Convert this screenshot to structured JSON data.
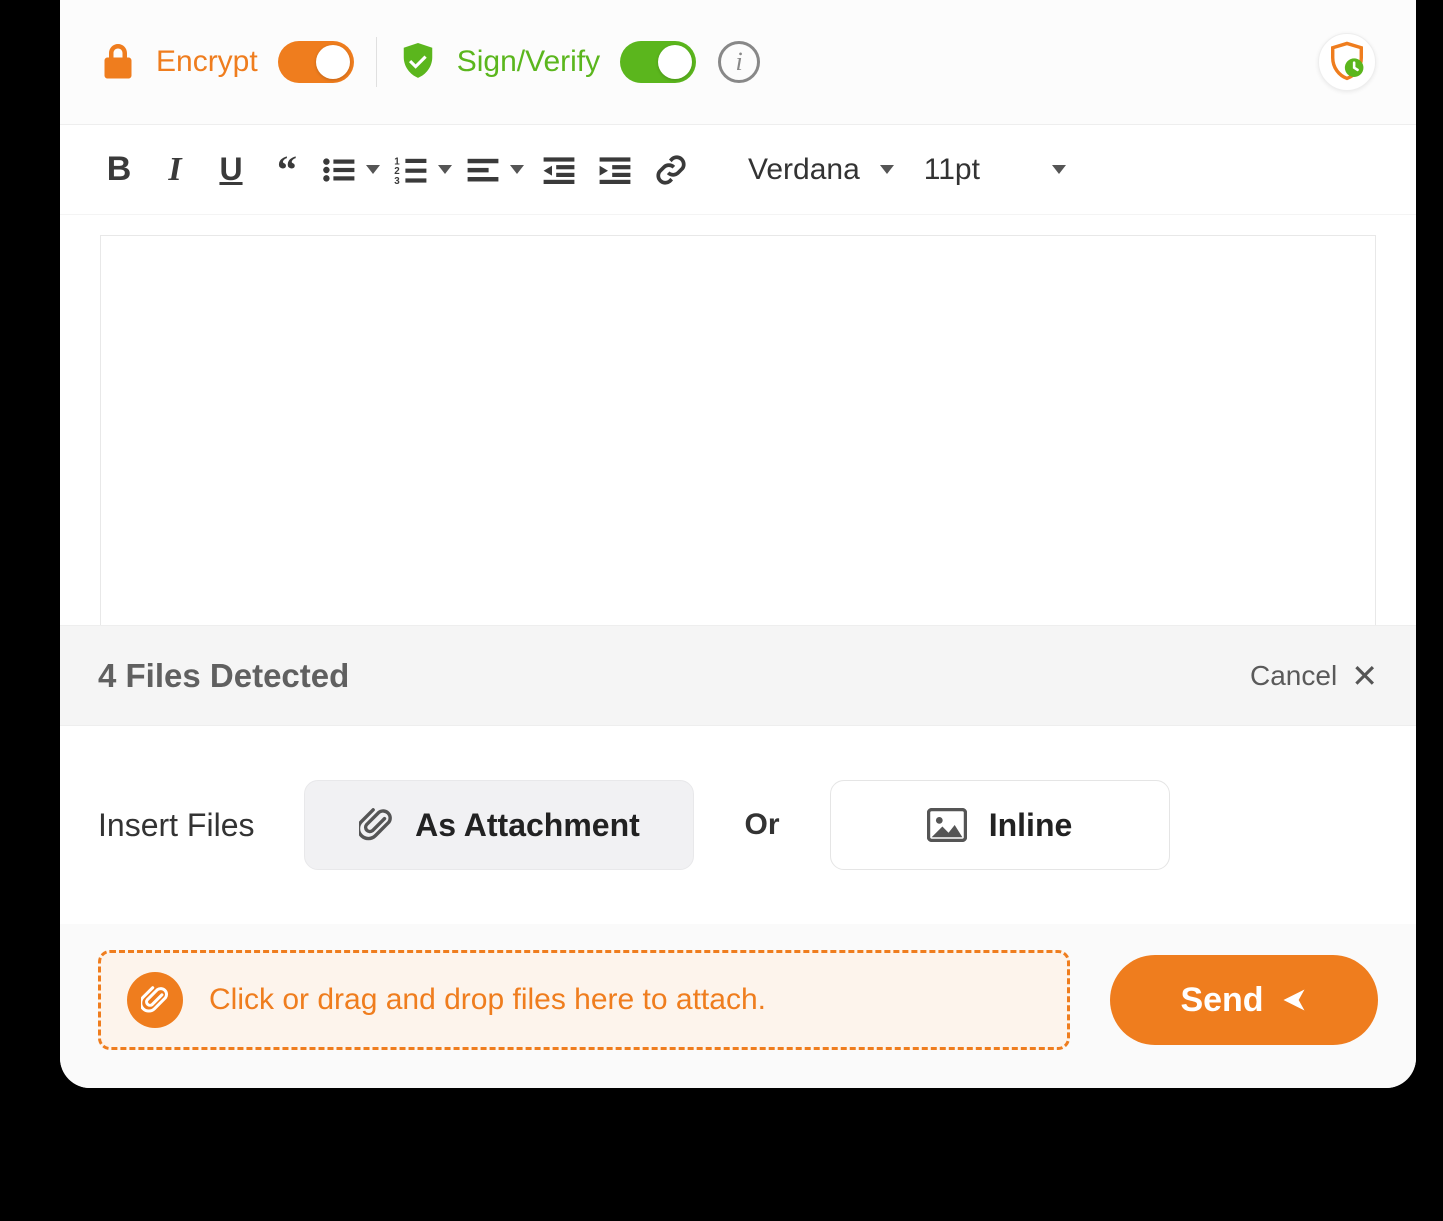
{
  "security": {
    "encrypt_label": "Encrypt",
    "encrypt_on": true,
    "sign_label": "Sign/Verify",
    "sign_on": true
  },
  "editor": {
    "font_family": "Verdana",
    "font_size": "11pt",
    "body": ""
  },
  "attach_panel": {
    "header": "4 Files Detected",
    "cancel_label": "Cancel",
    "insert_label": "Insert Files",
    "as_attachment_label": "As Attachment",
    "or_label": "Or",
    "inline_label": "Inline"
  },
  "dropzone": {
    "text": "Click or drag and drop files here to attach."
  },
  "send": {
    "label": "Send"
  }
}
